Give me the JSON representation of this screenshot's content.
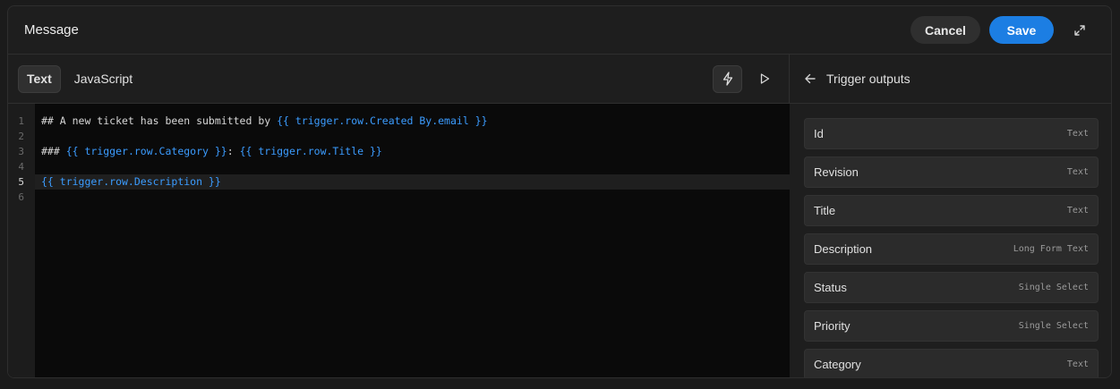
{
  "header": {
    "title": "Message",
    "cancel_label": "Cancel",
    "save_label": "Save",
    "expand_icon": "expand-icon"
  },
  "editor": {
    "tabs": [
      {
        "label": "Text",
        "active": true
      },
      {
        "label": "JavaScript",
        "active": false
      }
    ],
    "line_numbers": [
      "1",
      "2",
      "3",
      "4",
      "5",
      "6"
    ],
    "current_line": 5,
    "lines": {
      "l1_text": "## A new ticket has been submitted by ",
      "l1_binding": "{{ trigger.row.Created By.email }}",
      "l3_text": "### ",
      "l3_binding1": "{{ trigger.row.Category }}",
      "l3_sep": ": ",
      "l3_binding2": "{{ trigger.row.Title }}",
      "l5_binding": "{{ trigger.row.Description }}"
    }
  },
  "side": {
    "title": "Trigger outputs",
    "outputs": [
      {
        "name": "Id",
        "type": "Text"
      },
      {
        "name": "Revision",
        "type": "Text"
      },
      {
        "name": "Title",
        "type": "Text"
      },
      {
        "name": "Description",
        "type": "Long Form Text"
      },
      {
        "name": "Status",
        "type": "Single Select"
      },
      {
        "name": "Priority",
        "type": "Single Select"
      },
      {
        "name": "Category",
        "type": "Text"
      }
    ]
  },
  "colors": {
    "accent": "#1c7ee3",
    "binding": "#3b9cff",
    "background": "#1e1e1e",
    "code_background": "#0a0a0a"
  }
}
